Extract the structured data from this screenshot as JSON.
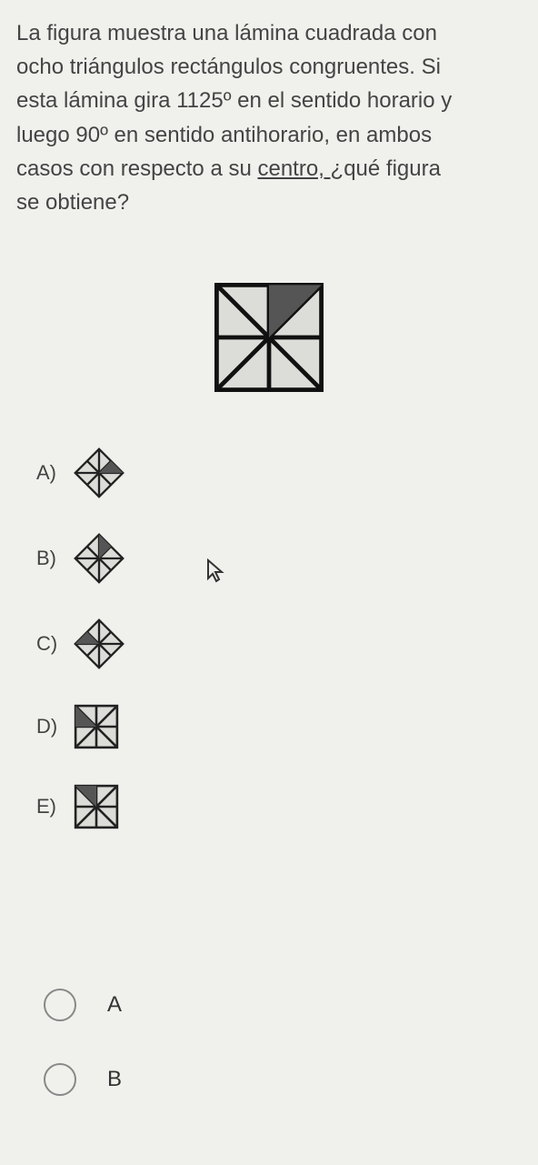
{
  "question": {
    "line1": "La figura muestra una lámina cuadrada con",
    "line2": "ocho triángulos rectángulos congruentes. Si",
    "line3": "esta lámina gira 1125º en el sentido horario y",
    "line4": "luego 90º en sentido antihorario, en ambos",
    "line5a": "casos con respecto a su ",
    "line5b_underlined": "centro, ",
    "line5c": " ¿qué figura",
    "line6": "se obtiene?"
  },
  "options": {
    "a": "A)",
    "b": "B)",
    "c": "C)",
    "d": "D)",
    "e": "E)"
  },
  "radios": {
    "a": "A",
    "b": "B"
  }
}
